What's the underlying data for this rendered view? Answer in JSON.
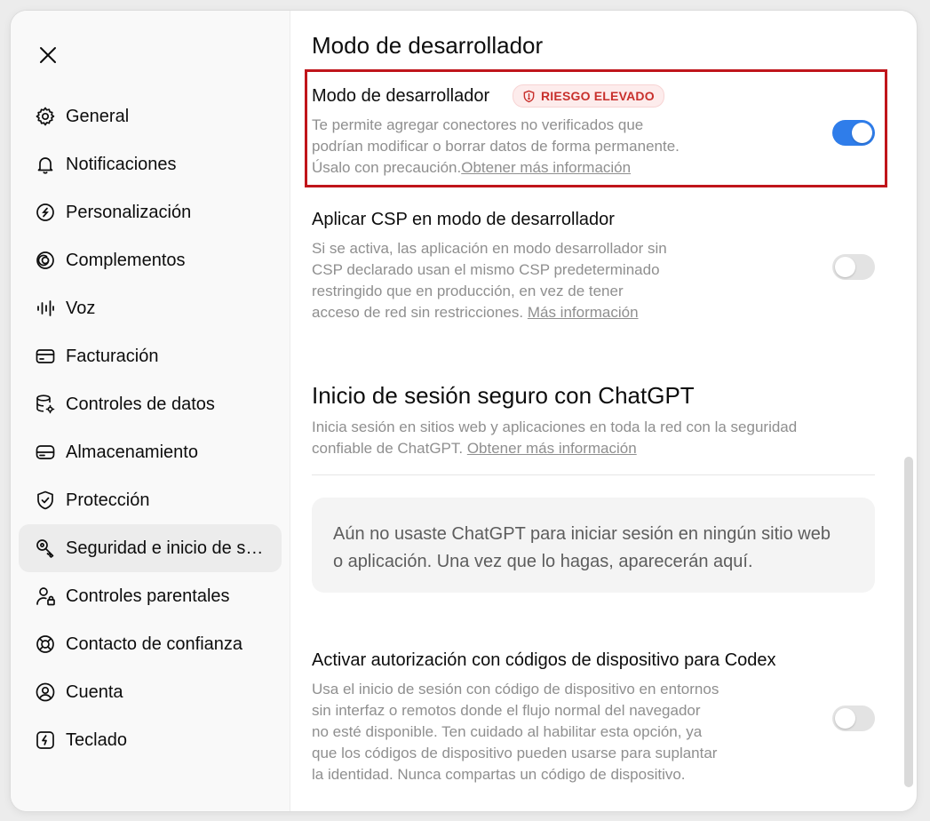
{
  "sidebar": {
    "items": [
      {
        "label": "General",
        "icon": "gear-icon"
      },
      {
        "label": "Notificaciones",
        "icon": "bell-icon"
      },
      {
        "label": "Personalización",
        "icon": "personalization-icon"
      },
      {
        "label": "Complementos",
        "icon": "plugins-icon"
      },
      {
        "label": "Voz",
        "icon": "voice-waveform-icon"
      },
      {
        "label": "Facturación",
        "icon": "credit-card-icon"
      },
      {
        "label": "Controles de datos",
        "icon": "database-settings-icon"
      },
      {
        "label": "Almacenamiento",
        "icon": "storage-drive-icon"
      },
      {
        "label": "Protección",
        "icon": "shield-check-icon"
      },
      {
        "label": "Seguridad e inicio de sesión",
        "icon": "key-icon",
        "active": true
      },
      {
        "label": "Controles parentales",
        "icon": "person-lock-icon"
      },
      {
        "label": "Contacto de confianza",
        "icon": "lifebuoy-icon"
      },
      {
        "label": "Cuenta",
        "icon": "account-circle-icon"
      },
      {
        "label": "Teclado",
        "icon": "keyboard-shortcut-icon"
      }
    ]
  },
  "main": {
    "dev_section_title": "Modo de desarrollador",
    "dev_mode": {
      "title": "Modo de desarrollador",
      "badge": "RIESGO ELEVADO",
      "desc_line1": "Te permite agregar conectores no verificados que",
      "desc_line2": "podrían modificar o borrar datos de forma permanente.",
      "desc_line3": "Úsalo con precaución.",
      "link": "Obtener más información",
      "enabled": true
    },
    "csp": {
      "title": "Aplicar CSP en modo de desarrollador",
      "desc_line1": "Si se activa, las aplicación en modo desarrollador sin",
      "desc_line2": "CSP declarado usan el mismo CSP predeterminado",
      "desc_line3": "restringido que en producción, en vez de tener",
      "desc_line4": "acceso de red sin restricciones. ",
      "link": "Más información",
      "enabled": false
    },
    "secure_login": {
      "title": "Inicio de sesión seguro con ChatGPT",
      "desc_line1": "Inicia sesión en sitios web y aplicaciones en toda la red con la seguridad",
      "desc_line2": "confiable de ChatGPT. ",
      "link": "Obtener más información",
      "empty_line1": "Aún no usaste ChatGPT para iniciar sesión en ningún sitio web",
      "empty_line2": "o aplicación. Una vez que lo hagas, aparecerán aquí."
    },
    "codex": {
      "title": "Activar autorización con códigos de dispositivo para Codex",
      "desc_line1": "Usa el inicio de sesión con código de dispositivo en entornos",
      "desc_line2": "sin interfaz o remotos donde el flujo normal del navegador",
      "desc_line3": "no esté disponible. Ten cuidado al habilitar esta opción, ya",
      "desc_line4": "que los códigos de dispositivo pueden usarse para suplantar",
      "desc_line5": "la identidad. Nunca compartas un código de dispositivo.",
      "enabled": false
    }
  },
  "colors": {
    "accent": "#2f7dea",
    "risk": "#c8302c",
    "highlight_border": "#c0151b"
  }
}
